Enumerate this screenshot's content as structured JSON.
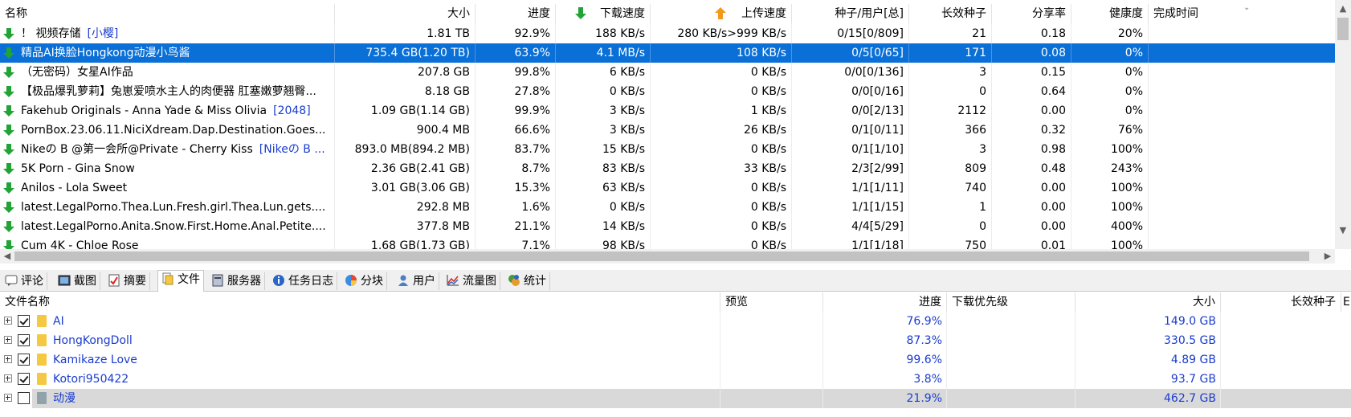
{
  "columns": {
    "name": "名称",
    "size": "大小",
    "progress": "进度",
    "download": "下载速度",
    "upload": "上传速度",
    "peers": "种子/用户[总]",
    "long_seeds": "长效种子",
    "ratio": "分享率",
    "health": "健康度",
    "completed": "完成时间"
  },
  "torrents": [
    {
      "name": "！ 视频存储",
      "tag": "[小樱]",
      "size": "1.81 TB",
      "progress": "92.9%",
      "down": "188 KB/s",
      "up": "280 KB/s>999 KB/s",
      "peers": "0/15[0/809]",
      "seeds": "21",
      "ratio": "0.18",
      "health": "20%"
    },
    {
      "name": "精品AI换脸Hongkong动漫小鸟酱",
      "tag": "",
      "size": "735.4 GB(1.20 TB)",
      "progress": "63.9%",
      "down": "4.1 MB/s",
      "up": "108 KB/s",
      "peers": "0/5[0/65]",
      "seeds": "171",
      "ratio": "0.08",
      "health": "0%"
    },
    {
      "name": "（无密码）女星AI作品",
      "tag": "",
      "size": "207.8 GB",
      "progress": "99.8%",
      "down": "6 KB/s",
      "up": "0 KB/s",
      "peers": "0/0[0/136]",
      "seeds": "3",
      "ratio": "0.15",
      "health": "0%"
    },
    {
      "name": "【极品爆乳萝莉】兔崽爱喷水主人的肉便器 肛塞嫩萝翘臀...",
      "tag": "",
      "size": "8.18 GB",
      "progress": "27.8%",
      "down": "0 KB/s",
      "up": "0 KB/s",
      "peers": "0/0[0/16]",
      "seeds": "0",
      "ratio": "0.64",
      "health": "0%"
    },
    {
      "name": "Fakehub Originals - Anna Yade & Miss Olivia",
      "tag": "[2048]",
      "size": "1.09 GB(1.14 GB)",
      "progress": "99.9%",
      "down": "3 KB/s",
      "up": "1 KB/s",
      "peers": "0/0[2/13]",
      "seeds": "2112",
      "ratio": "0.00",
      "health": "0%"
    },
    {
      "name": "PornBox.23.06.11.NiciXdream.Dap.Destination.Goes...",
      "tag": "",
      "size": "900.4 MB",
      "progress": "66.6%",
      "down": "3 KB/s",
      "up": "26 KB/s",
      "peers": "0/1[0/11]",
      "seeds": "366",
      "ratio": "0.32",
      "health": "76%"
    },
    {
      "name": "Nikeの B @第一会所@Private - Cherry Kiss",
      "tag": "[Nikeの B ...",
      "size": "893.0 MB(894.2 MB)",
      "progress": "83.7%",
      "down": "15 KB/s",
      "up": "0 KB/s",
      "peers": "0/1[1/10]",
      "seeds": "3",
      "ratio": "0.98",
      "health": "100%"
    },
    {
      "name": "5K Porn - Gina Snow",
      "tag": "",
      "size": "2.36 GB(2.41 GB)",
      "progress": "8.7%",
      "down": "83 KB/s",
      "up": "33 KB/s",
      "peers": "2/3[2/99]",
      "seeds": "809",
      "ratio": "0.48",
      "health": "243%"
    },
    {
      "name": "Anilos - Lola Sweet",
      "tag": "",
      "size": "3.01 GB(3.06 GB)",
      "progress": "15.3%",
      "down": "63 KB/s",
      "up": "0 KB/s",
      "peers": "1/1[1/11]",
      "seeds": "740",
      "ratio": "0.00",
      "health": "100%"
    },
    {
      "name": "latest.LegalPorno.Thea.Lun.Fresh.girl.Thea.Lun.gets....",
      "tag": "",
      "size": "292.8 MB",
      "progress": "1.6%",
      "down": "0 KB/s",
      "up": "0 KB/s",
      "peers": "1/1[1/15]",
      "seeds": "1",
      "ratio": "0.00",
      "health": "100%"
    },
    {
      "name": "latest.LegalPorno.Anita.Snow.First.Home.Anal.Petite....",
      "tag": "",
      "size": "377.8 MB",
      "progress": "21.1%",
      "down": "14 KB/s",
      "up": "0 KB/s",
      "peers": "4/4[5/29]",
      "seeds": "0",
      "ratio": "0.00",
      "health": "400%"
    },
    {
      "name": "Cum 4K - Chloe Rose",
      "tag": "",
      "size": "1.68 GB(1.73 GB)",
      "progress": "7.1%",
      "down": "98 KB/s",
      "up": "0 KB/s",
      "peers": "1/1[1/18]",
      "seeds": "750",
      "ratio": "0.01",
      "health": "100%"
    }
  ],
  "tabs": [
    "评论",
    "截图",
    "摘要",
    "文件",
    "服务器",
    "任务日志",
    "分块",
    "用户",
    "流量图",
    "统计"
  ],
  "file_columns": {
    "name": "文件名称",
    "preview": "预览",
    "progress": "进度",
    "priority": "下载优先级",
    "size": "大小",
    "long_seeds": "长效种子"
  },
  "files": [
    {
      "name": "AI",
      "progress": "76.9%",
      "size": "149.0 GB",
      "checked": true
    },
    {
      "name": "HongKongDoll",
      "progress": "87.3%",
      "size": "330.5 GB",
      "checked": true
    },
    {
      "name": "Kamikaze Love",
      "progress": "99.6%",
      "size": "4.89 GB",
      "checked": true
    },
    {
      "name": "Kotori950422",
      "progress": "3.8%",
      "size": "93.7 GB",
      "checked": true
    },
    {
      "name": "动漫",
      "progress": "21.9%",
      "size": "462.7 GB",
      "checked": false
    }
  ]
}
